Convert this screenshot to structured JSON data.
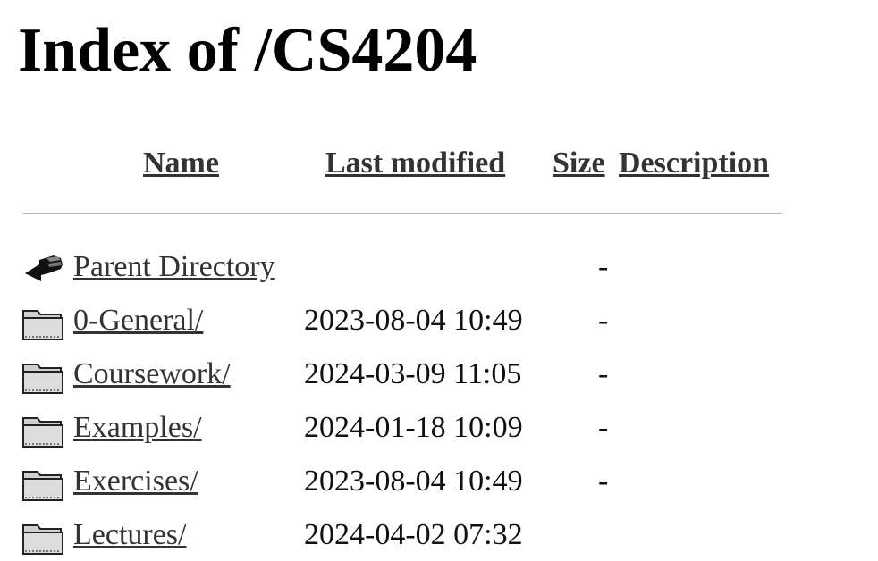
{
  "page": {
    "title": "Index of /CS4204"
  },
  "columns": {
    "name": "Name",
    "last_modified": "Last modified",
    "size": "Size",
    "description": "Description"
  },
  "rows": [
    {
      "icon": "back-arrow-icon",
      "name": "Parent Directory",
      "date": "",
      "size": "-"
    },
    {
      "icon": "folder-icon",
      "name": "0-General/",
      "date": "2023-08-04 10:49",
      "size": "-"
    },
    {
      "icon": "folder-icon",
      "name": "Coursework/",
      "date": "2024-03-09 11:05",
      "size": "-"
    },
    {
      "icon": "folder-icon",
      "name": "Examples/",
      "date": "2024-01-18 10:09",
      "size": "-"
    },
    {
      "icon": "folder-icon",
      "name": "Exercises/",
      "date": "2023-08-04 10:49",
      "size": "-"
    },
    {
      "icon": "folder-icon",
      "name": "Lectures/",
      "date": "2024-04-02 07:32",
      "size": ""
    }
  ]
}
